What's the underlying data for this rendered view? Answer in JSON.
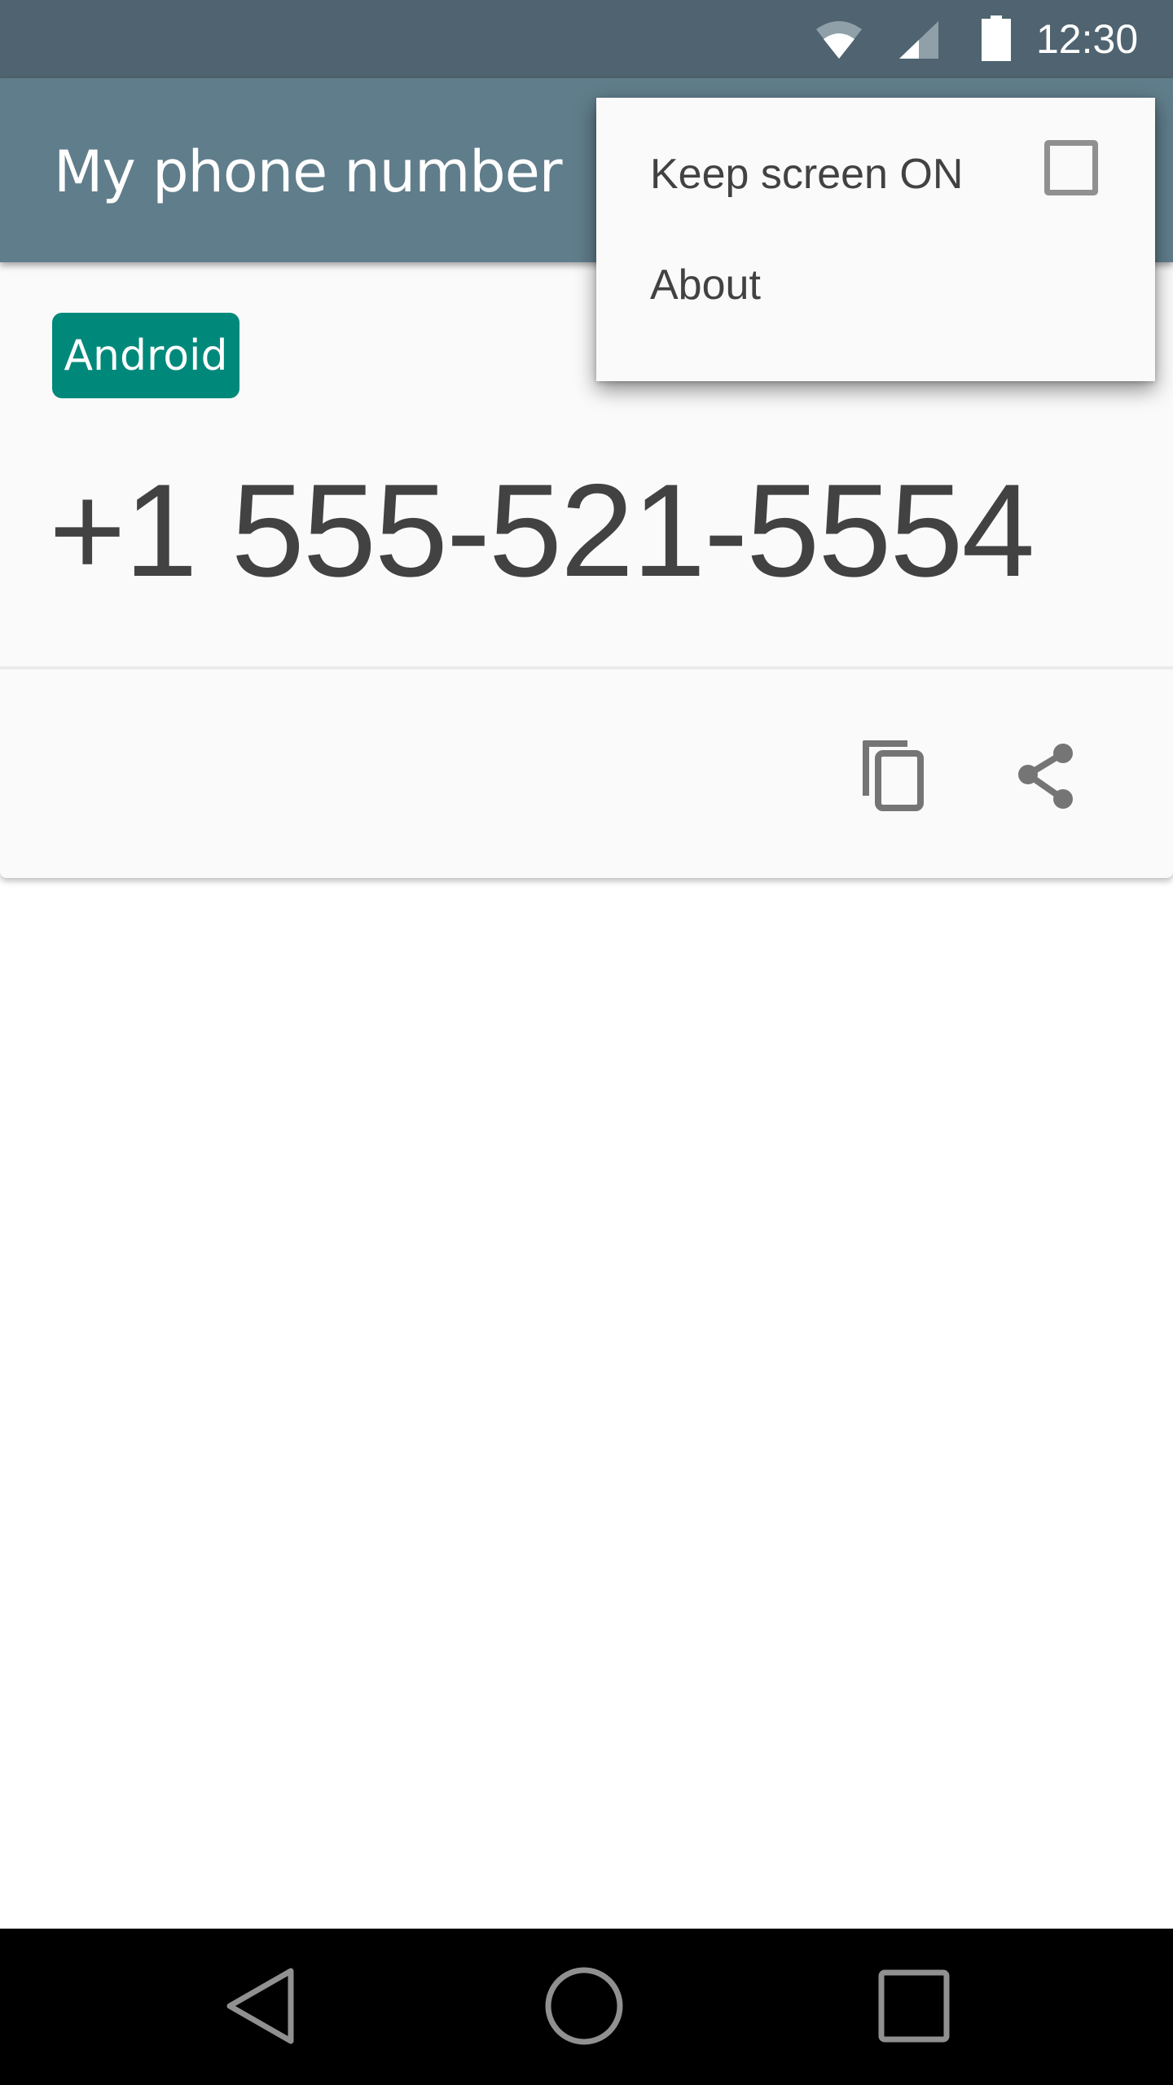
{
  "status_bar": {
    "time": "12:30",
    "icons": [
      "wifi-icon",
      "cell-signal-icon",
      "battery-icon"
    ]
  },
  "app_bar": {
    "title": "My phone number"
  },
  "card": {
    "chip_label": "Android",
    "phone_number": "+1 555-521-5554",
    "actions": [
      {
        "name": "copy",
        "icon": "copy-icon"
      },
      {
        "name": "share",
        "icon": "share-icon"
      }
    ]
  },
  "overflow_menu": {
    "items": [
      {
        "label": "Keep screen ON",
        "type": "checkbox",
        "checked": false
      },
      {
        "label": "About",
        "type": "item"
      }
    ]
  },
  "nav_bar": {
    "buttons": [
      "back",
      "home",
      "recents"
    ]
  },
  "colors": {
    "status_bar": "#4f6470",
    "app_bar": "#607d8b",
    "chip": "#00897b",
    "text_primary": "#424242",
    "icon_gray": "#757575"
  }
}
